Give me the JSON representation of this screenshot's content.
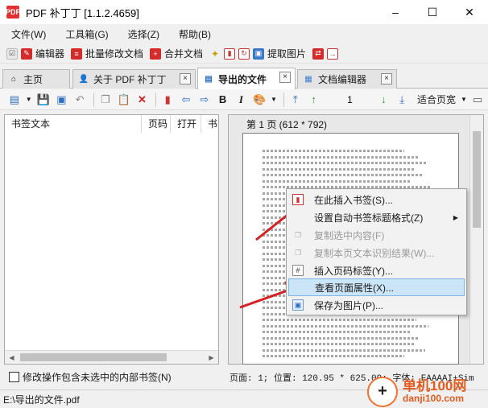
{
  "window": {
    "title": "PDF 补丁丁 [1.1.2.4659]",
    "logo": "PDF",
    "minimize": "–",
    "maximize": "☐",
    "close": "✕"
  },
  "menu": [
    "文件(W)",
    "工具箱(G)",
    "选择(Z)",
    "帮助(B)"
  ],
  "quickbar": {
    "editor": "编辑器",
    "batch_modify": "批量修改文档",
    "merge": "合并文档",
    "extract_images": "提取图片"
  },
  "tabs": [
    {
      "label": "主页",
      "icon": "home-icon"
    },
    {
      "label": "关于 PDF 补丁丁",
      "icon": "person-icon"
    },
    {
      "label": "导出的文件",
      "icon": "bookmark-icon"
    },
    {
      "label": "文档编辑器",
      "icon": "document-icon"
    }
  ],
  "toolbar": {
    "page_number": "1",
    "fit_mode": "适合页宽",
    "bold_label": "B",
    "italic_label": "I"
  },
  "bookmarks": {
    "columns": [
      "书签文本",
      "页码",
      "打开",
      "书"
    ]
  },
  "viewer": {
    "page_label": "第 1 页 (612 * 792)"
  },
  "context_menu": [
    {
      "label": "在此插入书签(S)...",
      "enabled": true,
      "icon": "bookmark-insert-icon"
    },
    {
      "label": "设置自动书签标题格式(Z)",
      "enabled": true,
      "icon": "",
      "submenu": true
    },
    {
      "label": "复制选中内容(F)",
      "enabled": false,
      "icon": "copy-icon"
    },
    {
      "label": "复制本页文本识别结果(W)...",
      "enabled": false,
      "icon": "ocr-copy-icon"
    },
    {
      "label": "插入页码标签(Y)...",
      "enabled": true,
      "icon": "hash-icon"
    },
    {
      "label": "查看页面属性(X)...",
      "enabled": true,
      "icon": "",
      "highlighted": true
    },
    {
      "label": "保存为图片(P)...",
      "enabled": true,
      "icon": "image-icon"
    }
  ],
  "status": {
    "checkbox_label": "修改操作包含未选中的内部书签(N)",
    "info": "页面: 1; 位置: 120.95 * 625.09; 字体: FAAAAI+Sim",
    "file_path": "E:\\导出的文件.pdf"
  },
  "watermark": {
    "name": "单机100网",
    "url": "danji100.com"
  },
  "colors": {
    "accent": "#cce4f7",
    "arrow": "#d42020",
    "pdf_red": "#d42b2b"
  }
}
